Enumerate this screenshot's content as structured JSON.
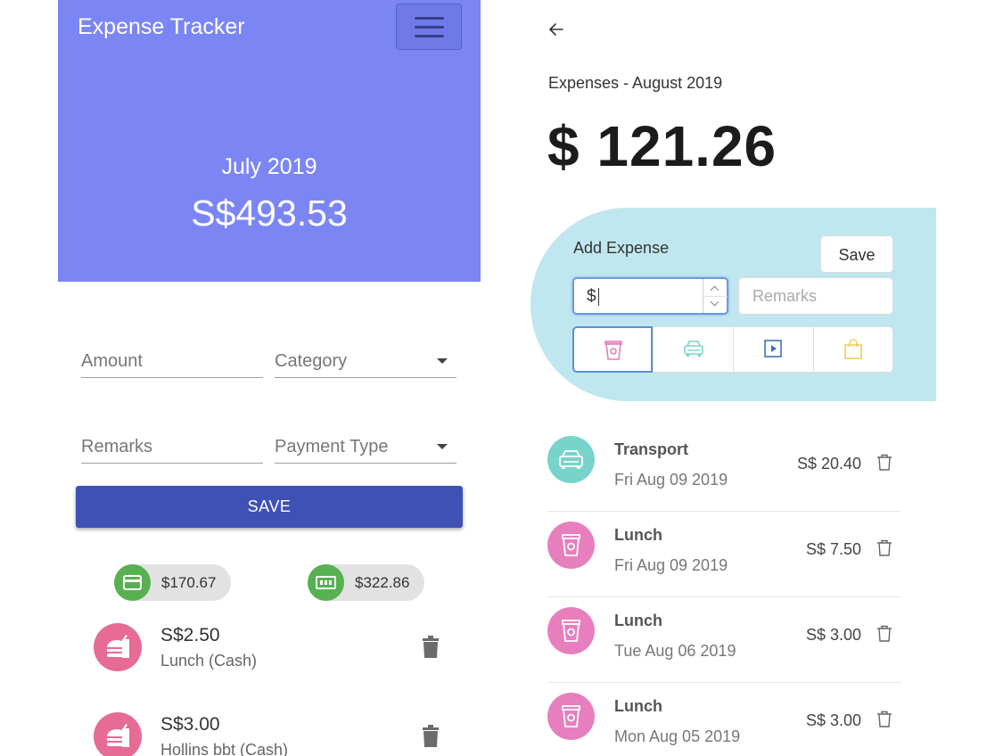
{
  "left": {
    "title": "Expense Tracker",
    "month": "July 2019",
    "total": "S$493.53",
    "form": {
      "amount_placeholder": "Amount",
      "category_placeholder": "Category",
      "remarks_placeholder": "Remarks",
      "payment_placeholder": "Payment Type",
      "save_label": "SAVE"
    },
    "summary": [
      {
        "icon": "credit-card-icon",
        "value": "$170.67"
      },
      {
        "icon": "cash-icon",
        "value": "$322.86"
      }
    ],
    "entries": [
      {
        "amount": "S$2.50",
        "desc": "Lunch (Cash)",
        "icon": "food-icon"
      },
      {
        "amount": "S$3.00",
        "desc": "Hollins bbt (Cash)",
        "icon": "food-icon"
      }
    ],
    "colors": {
      "header": "#7b86f4",
      "save": "#3f51b5",
      "chip_icon": "#57b151",
      "avatar": "#e66b95"
    }
  },
  "right": {
    "period": "Expenses - August 2019",
    "total": "$ 121.26",
    "add": {
      "label": "Add Expense",
      "save_label": "Save",
      "amount_value": "$",
      "remarks_placeholder": "Remarks",
      "categories": [
        "food-icon",
        "transport-icon",
        "entertainment-icon",
        "shopping-icon"
      ]
    },
    "expenses": [
      {
        "category": "Transport",
        "date": "Fri Aug 09 2019",
        "amount": "S$ 20.40",
        "icon": "car-icon",
        "color": "#78d4cb"
      },
      {
        "category": "Lunch",
        "date": "Fri Aug 09 2019",
        "amount": "S$ 7.50",
        "icon": "cup-icon",
        "color": "#e77fbe"
      },
      {
        "category": "Lunch",
        "date": "Tue Aug 06 2019",
        "amount": "S$ 3.00",
        "icon": "cup-icon",
        "color": "#e77fbe"
      },
      {
        "category": "Lunch",
        "date": "Mon Aug 05 2019",
        "amount": "S$ 3.00",
        "icon": "cup-icon",
        "color": "#e77fbe"
      }
    ],
    "colors": {
      "panel": "#c0e7ef",
      "accent": "#5b8fd9"
    }
  }
}
